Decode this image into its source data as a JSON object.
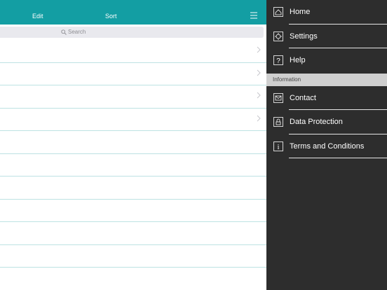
{
  "toolbar": {
    "edit_label": "Edit",
    "sort_label": "Sort",
    "menu_icon": "hamburger-menu-icon"
  },
  "search": {
    "placeholder": "Search"
  },
  "list": {
    "rows": 11,
    "chevron_rows": 4
  },
  "drawer": {
    "items": [
      {
        "label": "Home",
        "icon": "home-icon"
      },
      {
        "label": "Settings",
        "icon": "gear-icon"
      },
      {
        "label": "Help",
        "icon": "question-icon"
      }
    ],
    "section_title": "Information",
    "info_items": [
      {
        "label": "Contact",
        "icon": "envelope-icon"
      },
      {
        "label": "Data Protection",
        "icon": "lock-icon"
      },
      {
        "label": "Terms and Conditions",
        "icon": "info-icon"
      }
    ]
  },
  "colors": {
    "accent": "#139ea3",
    "drawer_bg": "#2d2d2d",
    "section_bg": "#cfcfcf",
    "row_divider": "#bde2e3"
  }
}
